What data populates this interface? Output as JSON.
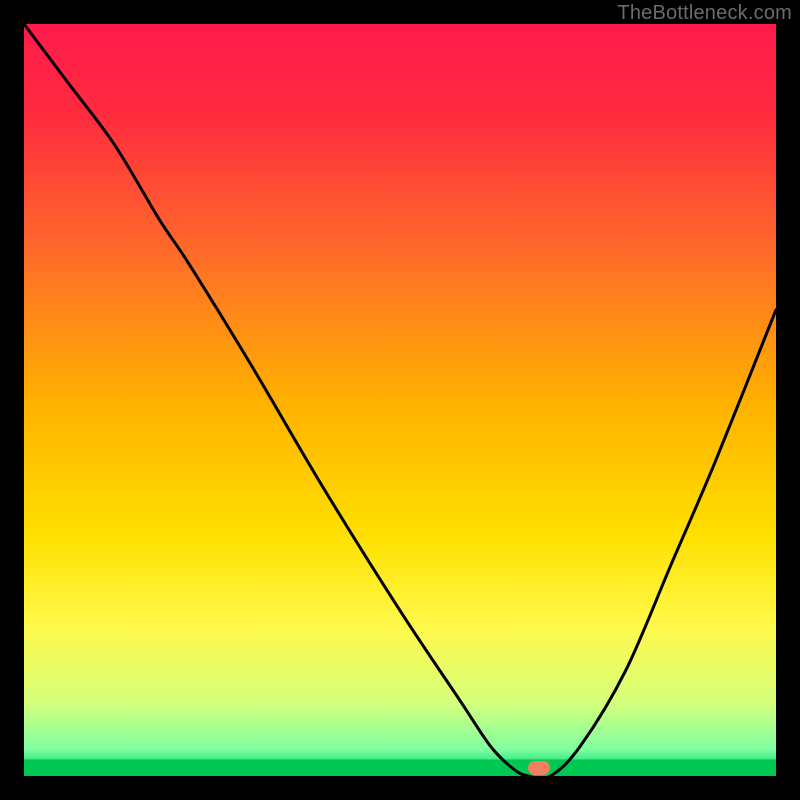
{
  "watermark": "TheBottleneck.com",
  "chart_data": {
    "type": "line",
    "title": "",
    "xlabel": "",
    "ylabel": "",
    "xlim": [
      0,
      100
    ],
    "ylim": [
      0,
      100
    ],
    "gradient_stops": [
      {
        "offset": 0,
        "color": "#ff1a4b"
      },
      {
        "offset": 0.12,
        "color": "#ff2b3f"
      },
      {
        "offset": 0.3,
        "color": "#ff6a2a"
      },
      {
        "offset": 0.5,
        "color": "#ffb000"
      },
      {
        "offset": 0.68,
        "color": "#ffe000"
      },
      {
        "offset": 0.8,
        "color": "#fff94a"
      },
      {
        "offset": 0.9,
        "color": "#d8ff7a"
      },
      {
        "offset": 0.965,
        "color": "#7effa0"
      },
      {
        "offset": 0.985,
        "color": "#22e07a"
      },
      {
        "offset": 1.0,
        "color": "#00c853"
      }
    ],
    "series": [
      {
        "name": "bottleneck-curve",
        "x": [
          0,
          6,
          12,
          18,
          22,
          30,
          40,
          50,
          58,
          62,
          65,
          67,
          70,
          74,
          80,
          86,
          92,
          100
        ],
        "y": [
          100,
          92,
          84,
          74,
          68,
          55,
          38,
          22,
          10,
          4,
          1,
          0,
          0,
          4,
          14,
          28,
          42,
          62
        ]
      }
    ],
    "marker": {
      "x": 68.5,
      "y": 1.0,
      "color": "#f08060"
    },
    "green_band": {
      "y_top": 2.2,
      "y_bottom": 0
    }
  }
}
